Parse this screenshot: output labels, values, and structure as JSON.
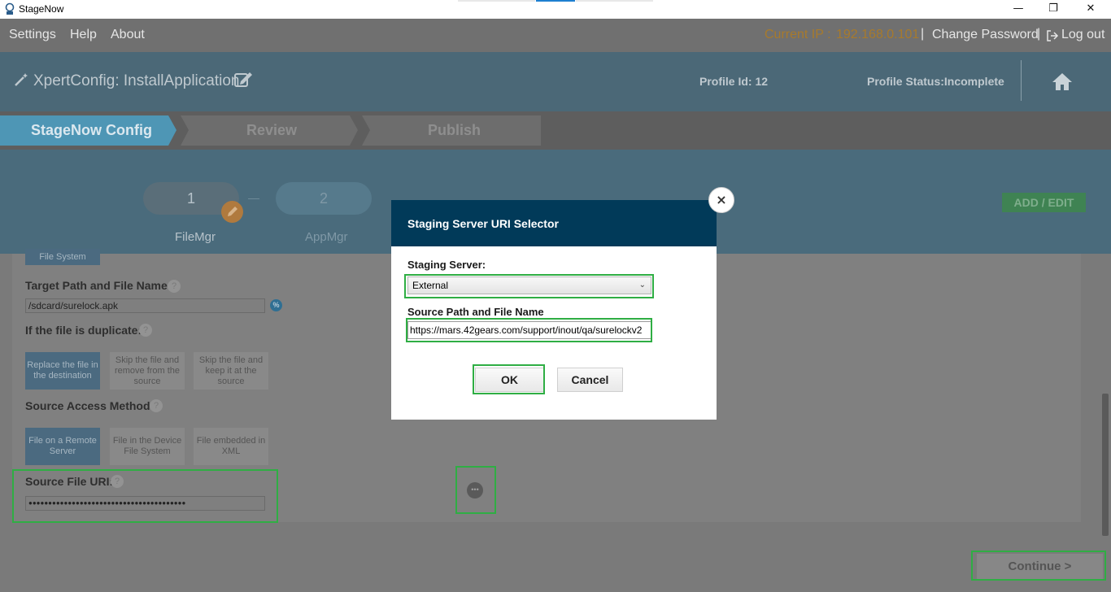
{
  "window": {
    "title": "StageNow",
    "minimize_glyph": "—",
    "maximize_glyph": "❐",
    "close_glyph": "✕"
  },
  "menubar": {
    "items": [
      "Settings",
      "Help",
      "About"
    ],
    "current_ip_label": "Current IP :",
    "current_ip_value": "192.168.0.101",
    "separator": "|",
    "change_password": "Change Password",
    "logout": "Log out"
  },
  "header": {
    "title": "XpertConfig: InstallApplication",
    "profile_id": "Profile Id: 12",
    "profile_status": "Profile Status:Incomplete"
  },
  "tabs": [
    {
      "label": "StageNow Config",
      "active": true
    },
    {
      "label": "Review",
      "active": false
    },
    {
      "label": "Publish",
      "active": false
    }
  ],
  "steps": [
    {
      "number": "1",
      "name": "FileMgr"
    },
    {
      "number": "2",
      "name": "AppMgr"
    }
  ],
  "add_edit_label": "ADD / EDIT",
  "form": {
    "partial_button": "File System",
    "target_path_label": "Target Path and File Name:",
    "target_path_value": "/sdcard/surelock.apk",
    "duplicate_label": "If the file is duplicate:",
    "duplicate_options": [
      "Replace the file in the destination",
      "Skip the file and remove from the source",
      "Skip the file and keep it at the source"
    ],
    "access_method_label": "Source Access Method:",
    "access_options": [
      "File on a Remote Server",
      "File in the Device File System",
      "File embedded in XML"
    ],
    "source_uri_label": "Source File URI:",
    "source_uri_value": "●●●●●●●●●●●●●●●●●●●●●●●●●●●●●●●●●●●●●●●●",
    "help_glyph": "?",
    "percent_glyph": "%",
    "dots_glyph": "•••"
  },
  "continue_label": "Continue   >",
  "modal": {
    "title": "Staging Server URI Selector",
    "close_glyph": "×",
    "staging_server_label": "Staging Server:",
    "staging_server_value": "External",
    "source_path_label": "Source Path and File Name",
    "source_path_value": "https://mars.42gears.com/support/inout/qa/surelockv2",
    "ok_label": "OK",
    "cancel_label": "Cancel"
  },
  "colors": {
    "modal_header": "#013a59",
    "highlight_box": "#2fae44",
    "tab_active": "#4e96b5"
  }
}
